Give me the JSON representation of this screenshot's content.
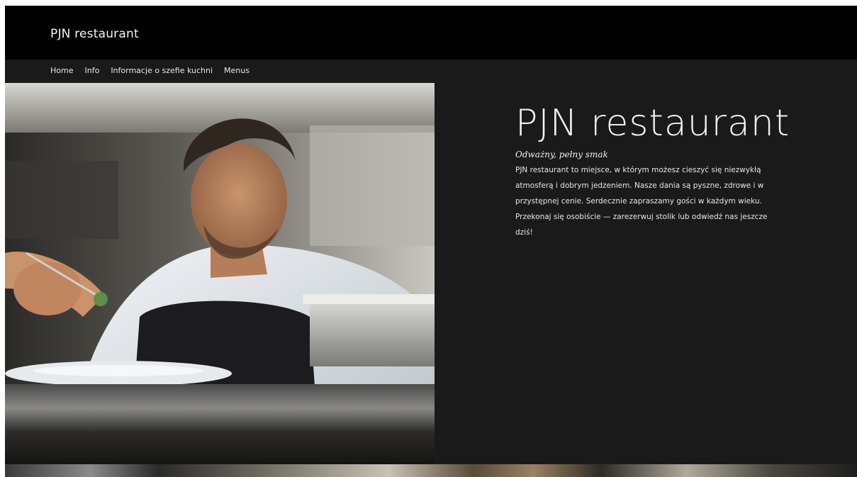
{
  "header": {
    "site_title": "PJN restaurant"
  },
  "nav": {
    "items": [
      "Home",
      "Info",
      "Informacje o szefie kuchni",
      "Menus"
    ]
  },
  "hero": {
    "title": "PJN restaurant",
    "tagline": "Odważny, pełny smak",
    "body": "PJN restaurant to miejsce, w którym możesz cieszyć się niezwykłą atmosferą i dobrym jedzeniem. Nasze dania są pyszne, zdrowe i w przystępnej cenie. Serdecznie zapraszamy gości w każdym wieku. Przekonaj się osobiście — zarezerwuj stolik lub odwiedź nas jeszcze dziś!"
  },
  "colors": {
    "header_bg": "#000000",
    "page_bg": "#1a1a1a",
    "text": "#f2f2f2"
  }
}
